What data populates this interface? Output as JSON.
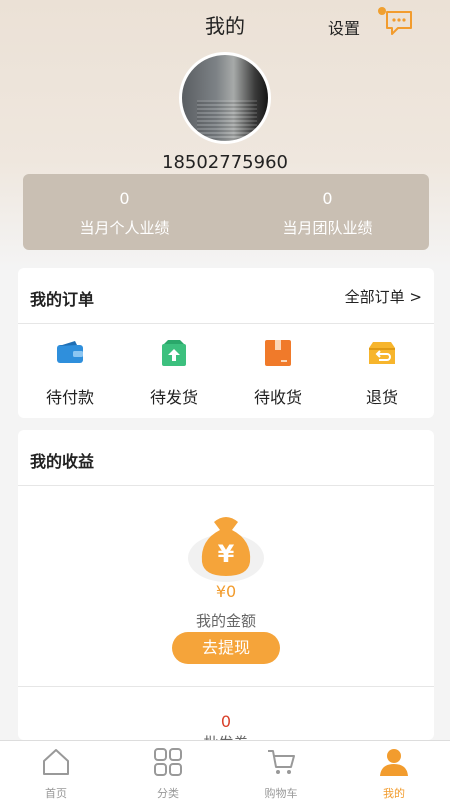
{
  "header": {
    "title": "我的",
    "settings_label": "设置"
  },
  "icons": {
    "message": "chat-bubble-icon"
  },
  "profile": {
    "phone": "18502775960"
  },
  "stats": [
    {
      "value": "0",
      "label": "当月个人业绩"
    },
    {
      "value": "0",
      "label": "当月团队业绩"
    }
  ],
  "orders": {
    "title": "我的订单",
    "all_link": "全部订单 >",
    "items": [
      {
        "label": "待付款",
        "icon": "wallet-icon"
      },
      {
        "label": "待发货",
        "icon": "box-upload-icon"
      },
      {
        "label": "待收货",
        "icon": "package-icon"
      },
      {
        "label": "退货",
        "icon": "return-icon"
      }
    ]
  },
  "income": {
    "title": "我的收益",
    "amount": "¥0",
    "amount_label": "我的金额",
    "withdraw_label": "去提现",
    "sub_value": "0",
    "sub_label": "批发券"
  },
  "tabbar": [
    {
      "label": "首页",
      "icon": "home-icon"
    },
    {
      "label": "分类",
      "icon": "grid-icon"
    },
    {
      "label": "购物车",
      "icon": "cart-icon"
    },
    {
      "label": "我的",
      "icon": "user-icon",
      "active": true
    }
  ],
  "colors": {
    "accent": "#f29c2e",
    "stats_bg": "#c9bfb3",
    "wallet": "#2f8fdc",
    "ship": "#3cc07e",
    "receive": "#f07a2a",
    "return": "#f7b52c"
  }
}
